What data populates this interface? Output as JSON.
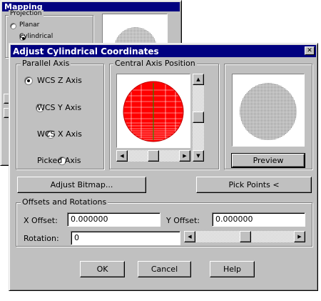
{
  "bg_window": {
    "title": "Mapping",
    "group_title": "Projection",
    "options": [
      "Planar",
      "Cylindrical"
    ]
  },
  "dialog": {
    "title": "Adjust Cylindrical Coordinates",
    "close_glyph": "✕",
    "parallel_axis": {
      "title": "Parallel Axis",
      "options": [
        "WCS Z Axis",
        "WCS Y Axis",
        "WCS X Axis",
        "Picked Axis"
      ],
      "selected": "WCS Z Axis"
    },
    "central_axis": {
      "title": "Central Axis Position"
    },
    "preview_button": "Preview",
    "adjust_bitmap_button": "Adjust Bitmap...",
    "pick_points_button": "Pick Points <",
    "offsets": {
      "title": "Offsets and Rotations",
      "x_label": "X Offset:",
      "x_value": "0.000000",
      "y_label": "Y Offset:",
      "y_value": "0.000000",
      "rotation_label": "Rotation:",
      "rotation_value": "0"
    },
    "ok_button": "OK",
    "cancel_button": "Cancel",
    "help_button": "Help"
  },
  "colors": {
    "title_bar": "#000080",
    "face": "#c0c0c0",
    "sphere_red": "#ff0000",
    "sphere_gray": "#a8a8a8"
  }
}
